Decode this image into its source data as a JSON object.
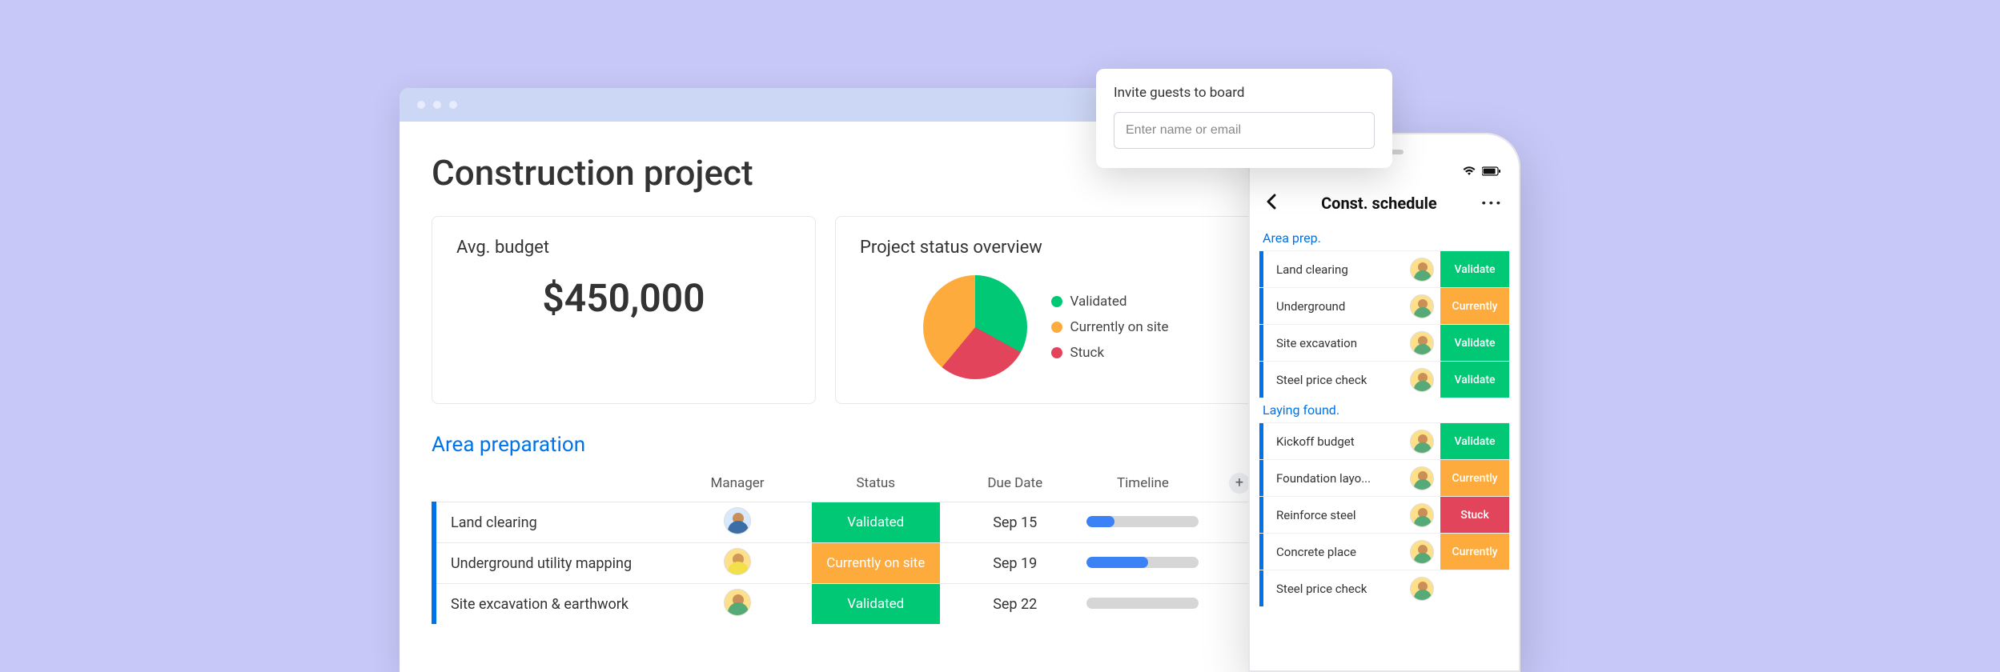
{
  "colors": {
    "green": "#00c875",
    "orange": "#fdab3d",
    "red": "#e2445c",
    "blue": "#0073ea"
  },
  "browser": {
    "page_title": "Construction project",
    "budget_card": {
      "title": "Avg. budget",
      "value": "$450,000"
    },
    "status_card": {
      "title": "Project status overview",
      "legend": [
        {
          "label": "Validated",
          "color": "#00c875"
        },
        {
          "label": "Currently on site",
          "color": "#fdab3d"
        },
        {
          "label": "Stuck",
          "color": "#e2445c"
        }
      ]
    },
    "section_title": "Area preparation",
    "columns": {
      "task": "",
      "manager": "Manager",
      "status": "Status",
      "due": "Due Date",
      "timeline": "Timeline"
    },
    "rows": [
      {
        "task": "Land clearing",
        "status": "Validated",
        "status_color": "#00c875",
        "due": "Sep 15",
        "timeline_pct": 25
      },
      {
        "task": "Underground utility mapping",
        "status": "Currently on site",
        "status_color": "#fdab3d",
        "due": "Sep 19",
        "timeline_pct": 55
      },
      {
        "task": "Site excavation & earthwork",
        "status": "Validated",
        "status_color": "#00c875",
        "due": "Sep 22",
        "timeline_pct": 0
      }
    ]
  },
  "chart_data": {
    "type": "pie",
    "title": "Project status overview",
    "series": [
      {
        "name": "Validated",
        "value": 33,
        "color": "#00c875"
      },
      {
        "name": "Stuck",
        "value": 28,
        "color": "#e2445c"
      },
      {
        "name": "Currently on site",
        "value": 39,
        "color": "#fdab3d"
      }
    ]
  },
  "invite": {
    "title": "Invite guests to board",
    "placeholder": "Enter name or email"
  },
  "phone": {
    "title": "Const. schedule",
    "sections": [
      {
        "title": "Area prep.",
        "rows": [
          {
            "name": "Land clearing",
            "status": "Validate",
            "status_color": "#00c875"
          },
          {
            "name": "Underground",
            "status": "Currently",
            "status_color": "#fdab3d"
          },
          {
            "name": "Site excavation",
            "status": "Validate",
            "status_color": "#00c875"
          },
          {
            "name": "Steel price check",
            "status": "Validate",
            "status_color": "#00c875"
          }
        ]
      },
      {
        "title": "Laying found.",
        "rows": [
          {
            "name": "Kickoff budget",
            "status": "Validate",
            "status_color": "#00c875"
          },
          {
            "name": "Foundation layo...",
            "status": "Currently",
            "status_color": "#fdab3d"
          },
          {
            "name": "Reinforce steel",
            "status": "Stuck",
            "status_color": "#e2445c"
          },
          {
            "name": "Concrete place",
            "status": "Currently",
            "status_color": "#fdab3d"
          },
          {
            "name": "Steel price check",
            "status": "",
            "status_color": "#ffffff"
          }
        ]
      }
    ]
  }
}
